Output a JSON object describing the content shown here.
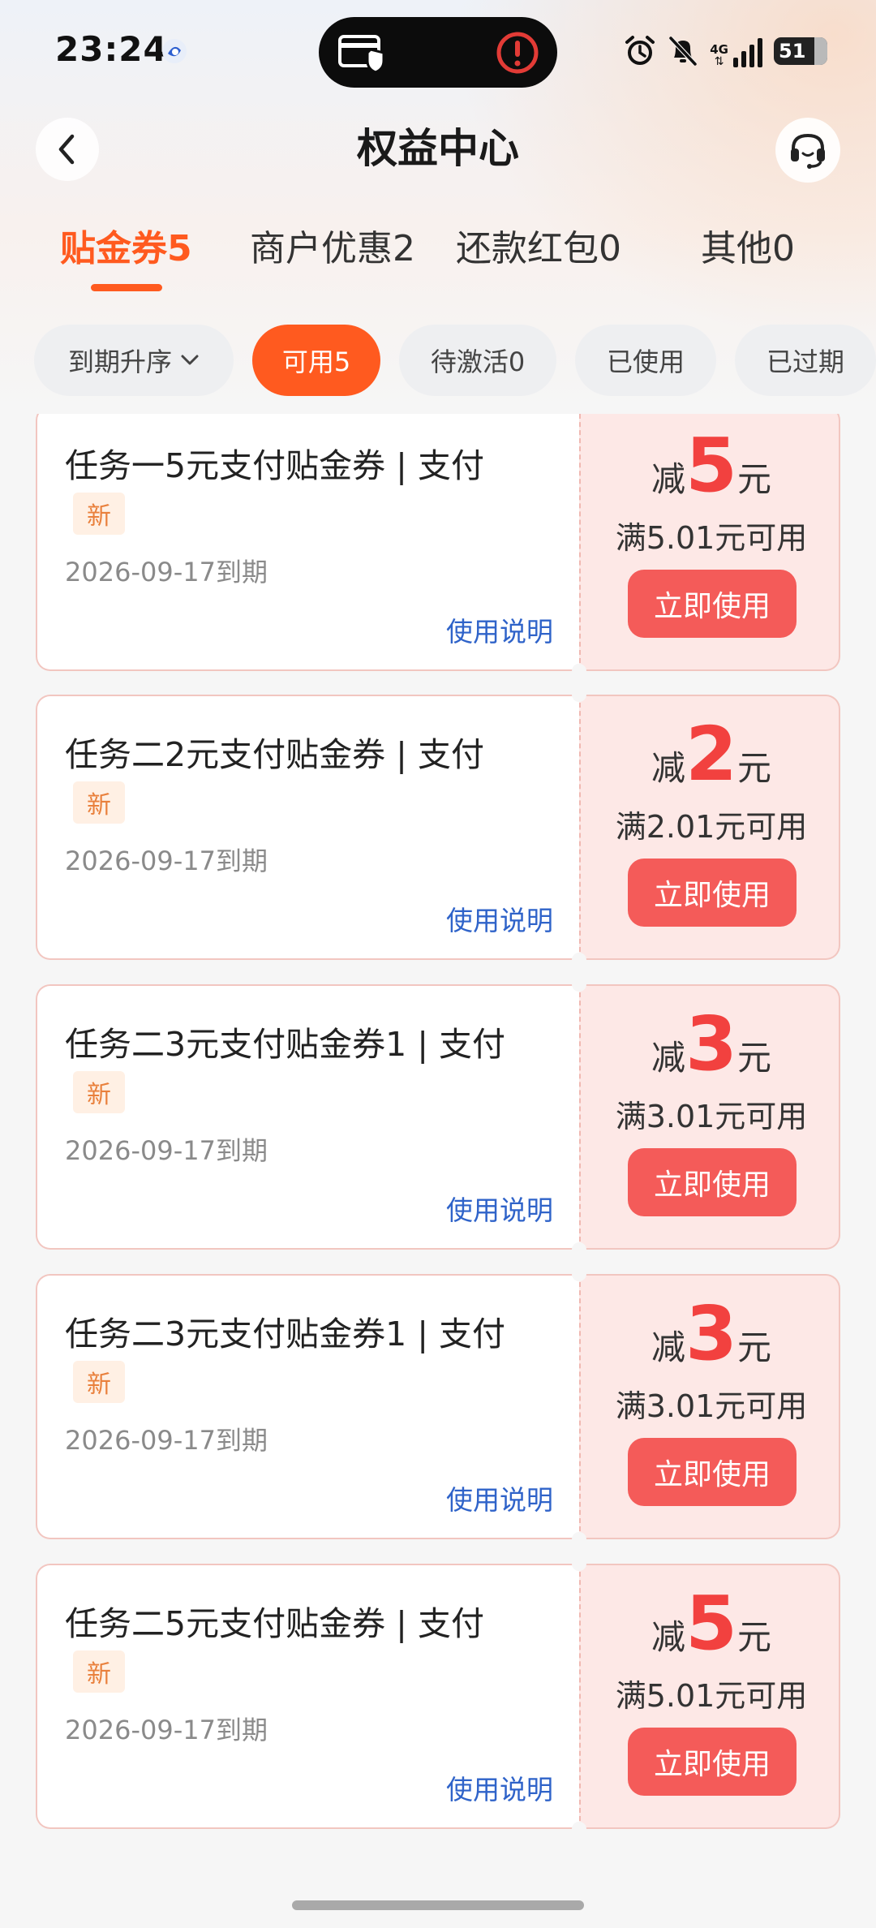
{
  "status_bar": {
    "time": "23:24",
    "network": "4G",
    "battery_level": "51",
    "icons": [
      "alarm-icon",
      "mute-icon",
      "signal-icon",
      "battery-icon"
    ]
  },
  "header": {
    "title": "权益中心",
    "back_icon": "chevron-left-icon",
    "service_icon": "headset-icon"
  },
  "tabs": [
    {
      "label": "贴金券5",
      "active": true
    },
    {
      "label": "商户优惠2",
      "active": false
    },
    {
      "label": "还款红包0",
      "active": false
    },
    {
      "label": "其他0",
      "active": false
    }
  ],
  "filters": {
    "sort": "到期升序",
    "chips": [
      {
        "label": "可用5",
        "active": true
      },
      {
        "label": "待激活0",
        "active": false
      },
      {
        "label": "已使用",
        "active": false
      },
      {
        "label": "已过期",
        "active": false
      }
    ]
  },
  "coupons": [
    {
      "title": "任务一5元支付贴金券 | 支付",
      "badge": "新",
      "expiry": "2026-09-17到期",
      "info": "使用说明",
      "prefix": "减",
      "amount": "5",
      "unit": "元",
      "condition": "满5.01元可用",
      "button": "立即使用"
    },
    {
      "title": "任务二2元支付贴金券 | 支付",
      "badge": "新",
      "expiry": "2026-09-17到期",
      "info": "使用说明",
      "prefix": "减",
      "amount": "2",
      "unit": "元",
      "condition": "满2.01元可用",
      "button": "立即使用"
    },
    {
      "title": "任务二3元支付贴金券1 | 支付",
      "badge": "新",
      "expiry": "2026-09-17到期",
      "info": "使用说明",
      "prefix": "减",
      "amount": "3",
      "unit": "元",
      "condition": "满3.01元可用",
      "button": "立即使用"
    },
    {
      "title": "任务二3元支付贴金券1 | 支付",
      "badge": "新",
      "expiry": "2026-09-17到期",
      "info": "使用说明",
      "prefix": "减",
      "amount": "3",
      "unit": "元",
      "condition": "满3.01元可用",
      "button": "立即使用"
    },
    {
      "title": "任务二5元支付贴金券 | 支付",
      "badge": "新",
      "expiry": "2026-09-17到期",
      "info": "使用说明",
      "prefix": "减",
      "amount": "5",
      "unit": "元",
      "condition": "满5.01元可用",
      "button": "立即使用"
    }
  ],
  "colors": {
    "accent": "#ff5a1f",
    "coupon_red": "#f2413f",
    "button_red": "#f45b59",
    "link_blue": "#2f63c9"
  }
}
